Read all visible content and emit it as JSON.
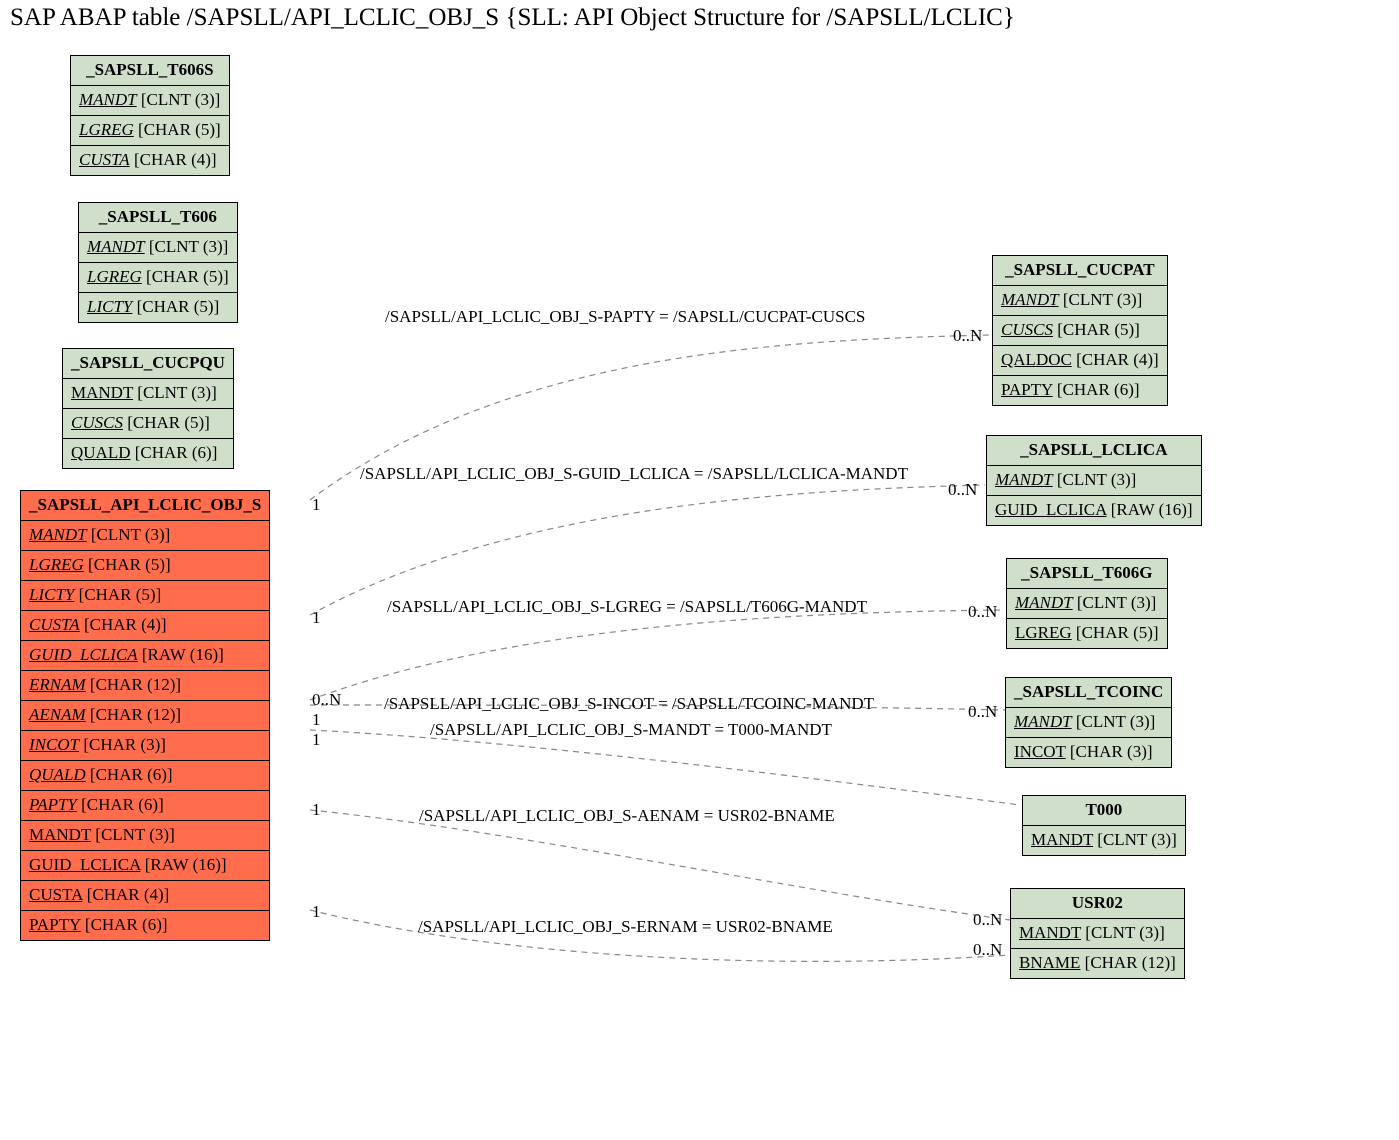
{
  "title": "SAP ABAP table /SAPSLL/API_LCLIC_OBJ_S {SLL: API Object Structure for /SAPSLL/LCLIC}",
  "t606s": {
    "name": "_SAPSLL_T606S",
    "f1": "MANDT",
    "t1": " [CLNT (3)]",
    "f2": "LGREG",
    "t2": " [CHAR (5)]",
    "f3": "CUSTA",
    "t3": " [CHAR (4)]"
  },
  "t606": {
    "name": "_SAPSLL_T606",
    "f1": "MANDT",
    "t1": " [CLNT (3)]",
    "f2": "LGREG",
    "t2": " [CHAR (5)]",
    "f3": "LICTY",
    "t3": " [CHAR (5)]"
  },
  "cucpqu": {
    "name": "_SAPSLL_CUCPQU",
    "f1": "MANDT",
    "t1": " [CLNT (3)]",
    "f2": "CUSCS",
    "t2": " [CHAR (5)]",
    "f3": "QUALD",
    "t3": " [CHAR (6)]"
  },
  "main": {
    "name": "_SAPSLL_API_LCLIC_OBJ_S",
    "f1": "MANDT",
    "t1": " [CLNT (3)]",
    "f2": "LGREG",
    "t2": " [CHAR (5)]",
    "f3": "LICTY",
    "t3": " [CHAR (5)]",
    "f4": "CUSTA",
    "t4": " [CHAR (4)]",
    "f5": "GUID_LCLICA",
    "t5": " [RAW (16)]",
    "f6": "ERNAM",
    "t6": " [CHAR (12)]",
    "f7": "AENAM",
    "t7": " [CHAR (12)]",
    "f8": "INCOT",
    "t8": " [CHAR (3)]",
    "f9": "QUALD",
    "t9": " [CHAR (6)]",
    "f10": "PAPTY",
    "t10": " [CHAR (6)]",
    "f11": "MANDT",
    "t11": " [CLNT (3)]",
    "f12": "GUID_LCLICA",
    "t12": " [RAW (16)]",
    "f13": "CUSTA",
    "t13": " [CHAR (4)]",
    "f14": "PAPTY",
    "t14": " [CHAR (6)]"
  },
  "cucpat": {
    "name": "_SAPSLL_CUCPAT",
    "f1": "MANDT",
    "t1": " [CLNT (3)]",
    "f2": "CUSCS",
    "t2": " [CHAR (5)]",
    "f3": "QALDOC",
    "t3": " [CHAR (4)]",
    "f4": "PAPTY",
    "t4": " [CHAR (6)]"
  },
  "lclica": {
    "name": "_SAPSLL_LCLICA",
    "f1": "MANDT",
    "t1": " [CLNT (3)]",
    "f2": "GUID_LCLICA",
    "t2": " [RAW (16)]"
  },
  "t606g": {
    "name": "_SAPSLL_T606G",
    "f1": "MANDT",
    "t1": " [CLNT (3)]",
    "f2": "LGREG",
    "t2": " [CHAR (5)]"
  },
  "tcoinc": {
    "name": "_SAPSLL_TCOINC",
    "f1": "MANDT",
    "t1": " [CLNT (3)]",
    "f2": "INCOT",
    "t2": " [CHAR (3)]"
  },
  "t000": {
    "name": "T000",
    "f1": "MANDT",
    "t1": " [CLNT (3)]"
  },
  "usr02": {
    "name": "USR02",
    "f1": "MANDT",
    "t1": " [CLNT (3)]",
    "f2": "BNAME",
    "t2": " [CHAR (12)]"
  },
  "rel1": "/SAPSLL/API_LCLIC_OBJ_S-PAPTY = /SAPSLL/CUCPAT-CUSCS",
  "rel2": "/SAPSLL/API_LCLIC_OBJ_S-GUID_LCLICA = /SAPSLL/LCLICA-MANDT",
  "rel3": "/SAPSLL/API_LCLIC_OBJ_S-LGREG = /SAPSLL/T606G-MANDT",
  "rel4": "/SAPSLL/API_LCLIC_OBJ_S-INCOT = /SAPSLL/TCOINC-MANDT",
  "rel5": "/SAPSLL/API_LCLIC_OBJ_S-MANDT = T000-MANDT",
  "rel6": "/SAPSLL/API_LCLIC_OBJ_S-AENAM = USR02-BNAME",
  "rel7": "/SAPSLL/API_LCLIC_OBJ_S-ERNAM = USR02-BNAME",
  "card1": "1",
  "card0n": "0..N",
  "chart_data": {
    "type": "er-diagram",
    "main_entity": "_SAPSLL_API_LCLIC_OBJ_S",
    "entities": [
      {
        "name": "_SAPSLL_T606S",
        "fields": [
          [
            "MANDT",
            "CLNT(3)",
            "pk"
          ],
          [
            "LGREG",
            "CHAR(5)",
            "pk"
          ],
          [
            "CUSTA",
            "CHAR(4)",
            "pk"
          ]
        ]
      },
      {
        "name": "_SAPSLL_T606",
        "fields": [
          [
            "MANDT",
            "CLNT(3)",
            "pk"
          ],
          [
            "LGREG",
            "CHAR(5)",
            "pk"
          ],
          [
            "LICTY",
            "CHAR(5)",
            "pk"
          ]
        ]
      },
      {
        "name": "_SAPSLL_CUCPQU",
        "fields": [
          [
            "MANDT",
            "CLNT(3)"
          ],
          [
            "CUSCS",
            "CHAR(5)",
            "pk"
          ],
          [
            "QUALD",
            "CHAR(6)"
          ]
        ]
      },
      {
        "name": "_SAPSLL_API_LCLIC_OBJ_S",
        "fields": [
          [
            "MANDT",
            "CLNT(3)",
            "pk"
          ],
          [
            "LGREG",
            "CHAR(5)",
            "pk"
          ],
          [
            "LICTY",
            "CHAR(5)",
            "pk"
          ],
          [
            "CUSTA",
            "CHAR(4)",
            "pk"
          ],
          [
            "GUID_LCLICA",
            "RAW(16)",
            "pk"
          ],
          [
            "ERNAM",
            "CHAR(12)",
            "pk"
          ],
          [
            "AENAM",
            "CHAR(12)",
            "pk"
          ],
          [
            "INCOT",
            "CHAR(3)",
            "pk"
          ],
          [
            "QUALD",
            "CHAR(6)",
            "pk"
          ],
          [
            "PAPTY",
            "CHAR(6)",
            "pk"
          ],
          [
            "MANDT",
            "CLNT(3)"
          ],
          [
            "GUID_LCLICA",
            "RAW(16)"
          ],
          [
            "CUSTA",
            "CHAR(4)"
          ],
          [
            "PAPTY",
            "CHAR(6)"
          ]
        ]
      },
      {
        "name": "_SAPSLL_CUCPAT",
        "fields": [
          [
            "MANDT",
            "CLNT(3)",
            "pk"
          ],
          [
            "CUSCS",
            "CHAR(5)",
            "pk"
          ],
          [
            "QALDOC",
            "CHAR(4)"
          ],
          [
            "PAPTY",
            "CHAR(6)"
          ]
        ]
      },
      {
        "name": "_SAPSLL_LCLICA",
        "fields": [
          [
            "MANDT",
            "CLNT(3)",
            "pk"
          ],
          [
            "GUID_LCLICA",
            "RAW(16)"
          ]
        ]
      },
      {
        "name": "_SAPSLL_T606G",
        "fields": [
          [
            "MANDT",
            "CLNT(3)",
            "pk"
          ],
          [
            "LGREG",
            "CHAR(5)"
          ]
        ]
      },
      {
        "name": "_SAPSLL_TCOINC",
        "fields": [
          [
            "MANDT",
            "CLNT(3)",
            "pk"
          ],
          [
            "INCOT",
            "CHAR(3)"
          ]
        ]
      },
      {
        "name": "T000",
        "fields": [
          [
            "MANDT",
            "CLNT(3)"
          ]
        ]
      },
      {
        "name": "USR02",
        "fields": [
          [
            "MANDT",
            "CLNT(3)"
          ],
          [
            "BNAME",
            "CHAR(12)"
          ]
        ]
      }
    ],
    "relations": [
      {
        "from": "_SAPSLL_API_LCLIC_OBJ_S",
        "to": "_SAPSLL_CUCPAT",
        "label": "/SAPSLL/API_LCLIC_OBJ_S-PAPTY = /SAPSLL/CUCPAT-CUSCS",
        "card_from": "1",
        "card_to": "0..N"
      },
      {
        "from": "_SAPSLL_API_LCLIC_OBJ_S",
        "to": "_SAPSLL_LCLICA",
        "label": "/SAPSLL/API_LCLIC_OBJ_S-GUID_LCLICA = /SAPSLL/LCLICA-MANDT",
        "card_from": "1",
        "card_to": "0..N"
      },
      {
        "from": "_SAPSLL_API_LCLIC_OBJ_S",
        "to": "_SAPSLL_T606G",
        "label": "/SAPSLL/API_LCLIC_OBJ_S-LGREG = /SAPSLL/T606G-MANDT",
        "card_from": "1",
        "card_to": "0..N"
      },
      {
        "from": "_SAPSLL_API_LCLIC_OBJ_S",
        "to": "_SAPSLL_TCOINC",
        "label": "/SAPSLL/API_LCLIC_OBJ_S-INCOT = /SAPSLL/TCOINC-MANDT",
        "card_from": "0..N",
        "card_to": "0..N"
      },
      {
        "from": "_SAPSLL_API_LCLIC_OBJ_S",
        "to": "T000",
        "label": "/SAPSLL/API_LCLIC_OBJ_S-MANDT = T000-MANDT",
        "card_from": "1",
        "card_to": ""
      },
      {
        "from": "_SAPSLL_API_LCLIC_OBJ_S",
        "to": "USR02",
        "label": "/SAPSLL/API_LCLIC_OBJ_S-AENAM = USR02-BNAME",
        "card_from": "1",
        "card_to": "0..N"
      },
      {
        "from": "_SAPSLL_API_LCLIC_OBJ_S",
        "to": "USR02",
        "label": "/SAPSLL/API_LCLIC_OBJ_S-ERNAM = USR02-BNAME",
        "card_from": "1",
        "card_to": "0..N"
      }
    ]
  }
}
